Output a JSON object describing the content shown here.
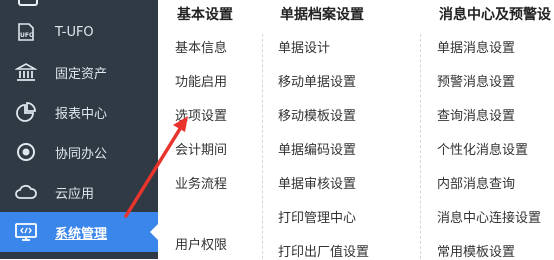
{
  "sidebar": {
    "items": [
      {
        "label": "T-UFO",
        "icon": "ufo-icon"
      },
      {
        "label": "固定资产",
        "icon": "bank-icon"
      },
      {
        "label": "报表中心",
        "icon": "pie-chart-icon"
      },
      {
        "label": "协同办公",
        "icon": "target-icon"
      },
      {
        "label": "云应用",
        "icon": "cloud-icon"
      },
      {
        "label": "系统管理",
        "icon": "monitor-code-icon",
        "active": true
      }
    ],
    "active_color": "#3b86ea",
    "background": "#2f3a44"
  },
  "menu": {
    "columns": [
      {
        "header": "基本设置",
        "items": [
          "基本信息",
          "功能启用",
          "选项设置",
          "会计期间",
          "业务流程",
          "用户权限"
        ]
      },
      {
        "header": "单据档案设置",
        "items": [
          "单据设计",
          "移动单据设置",
          "移动模板设置",
          "单据编码设置",
          "单据审核设置",
          "打印管理中心",
          "打印出厂值设置"
        ]
      },
      {
        "header": "消息中心及预警设",
        "items": [
          "单据消息设置",
          "预警消息设置",
          "查询消息设置",
          "个性化消息设置",
          "内部消息查询",
          "消息中心连接设置",
          "常用模板设置"
        ]
      }
    ]
  },
  "annotation": {
    "color": "#e8342c",
    "points_to": "选项设置"
  }
}
